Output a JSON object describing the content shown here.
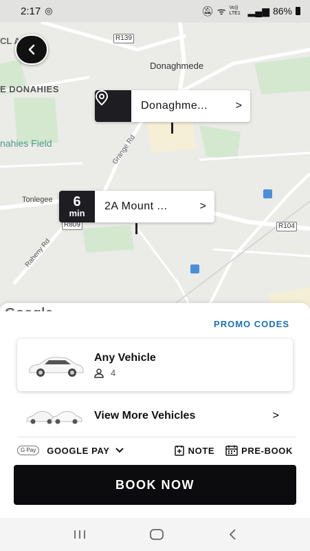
{
  "status_bar": {
    "time": "2:17",
    "battery": "86%",
    "network": "Vo)) LTE1"
  },
  "map": {
    "labels": {
      "donaghmede": "Donaghmede",
      "donahies": "E DONAHIES",
      "donahies_field": "nahies Field",
      "grange_rd": "Grange Rd",
      "raheny_rd": "Raheny Rd",
      "tonlegee": "Tonlegee",
      "cl_all": "CL ALL"
    },
    "road_tags": {
      "r139": "R139",
      "r809": "R809",
      "r104": "R104"
    },
    "google": "Google",
    "destination": {
      "address": "Donaghme..."
    },
    "pickup": {
      "eta_value": "6",
      "eta_unit": "min",
      "address": "2A Mount ..."
    }
  },
  "sheet": {
    "promo": "PROMO CODES",
    "vehicle": {
      "name": "Any Vehicle",
      "capacity": "4"
    },
    "more": "View More Vehicles",
    "payment": {
      "badge": "G Pay",
      "label": "GOOGLE PAY"
    },
    "note": "NOTE",
    "prebook": "PRE-BOOK",
    "book": "BOOK NOW"
  },
  "colors": {
    "accent": "#1b6fb8",
    "dark": "#0c0c0e"
  }
}
